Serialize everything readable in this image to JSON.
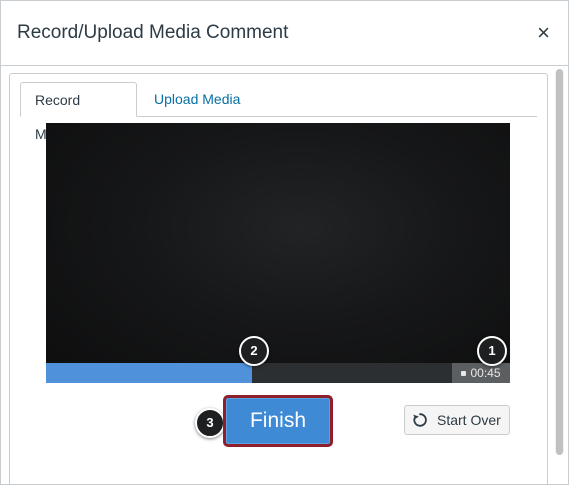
{
  "dialog": {
    "title": "Record/Upload Media Comment",
    "close_glyph": "×"
  },
  "tabs": [
    {
      "label": "Record Media",
      "active": true
    },
    {
      "label": "Upload Media",
      "active": false
    }
  ],
  "recorder": {
    "elapsed_time": "00:45",
    "progress_fraction": 0.445
  },
  "callouts": {
    "one": "1",
    "two": "2",
    "three": "3"
  },
  "actions": {
    "finish_label": "Finish",
    "start_over_label": "Start Over",
    "start_over_icon": "restart-icon"
  },
  "colors": {
    "accent": "#0770a3",
    "finish_button": "#3f8ad4",
    "highlight_border": "#8f1f2a",
    "progress_fill": "#4f92db"
  }
}
